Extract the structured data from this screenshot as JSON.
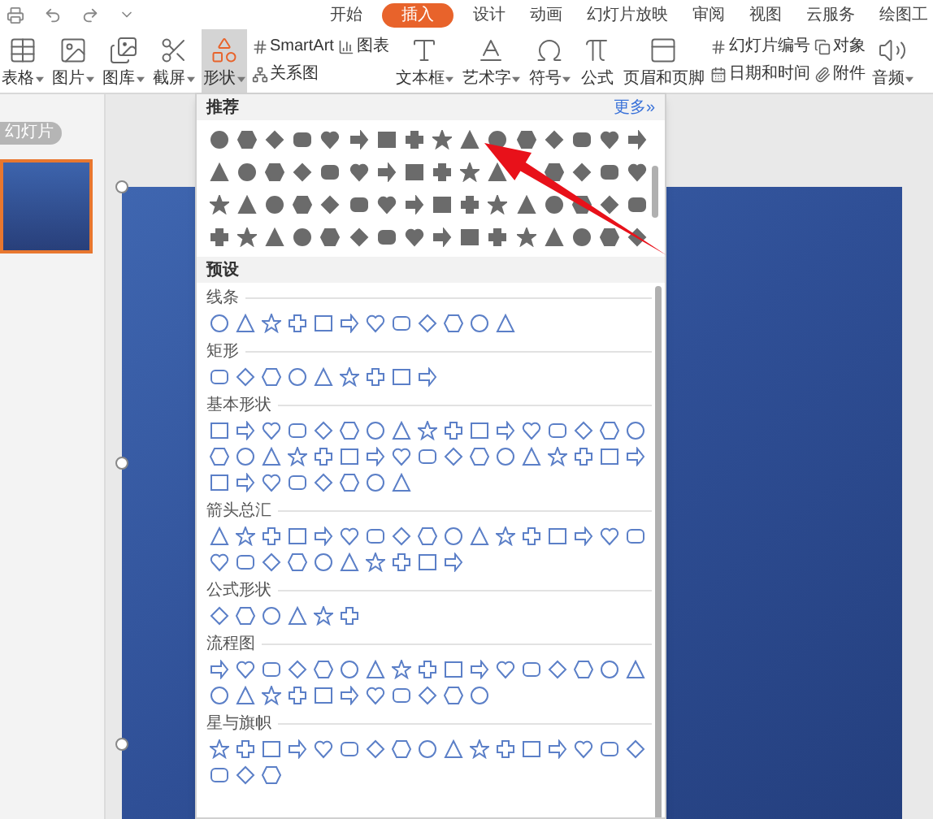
{
  "tabs": [
    {
      "label": "开始",
      "selected": false
    },
    {
      "label": "插入",
      "selected": true
    },
    {
      "label": "设计",
      "selected": false
    },
    {
      "label": "动画",
      "selected": false
    },
    {
      "label": "幻灯片放映",
      "selected": false
    },
    {
      "label": "审阅",
      "selected": false
    },
    {
      "label": "视图",
      "selected": false
    },
    {
      "label": "云服务",
      "selected": false
    },
    {
      "label": "绘图工",
      "selected": false
    }
  ],
  "ribbon": [
    {
      "kind": "large",
      "label": "表格",
      "dropdown": true,
      "selected": false
    },
    {
      "kind": "large",
      "label": "图片",
      "dropdown": true,
      "selected": false
    },
    {
      "kind": "large",
      "label": "图库",
      "dropdown": true,
      "selected": false
    },
    {
      "kind": "large",
      "label": "截屏",
      "dropdown": true,
      "selected": false
    },
    {
      "kind": "large",
      "label": "形状",
      "dropdown": true,
      "selected": true
    },
    {
      "kind": "stack",
      "items": [
        {
          "label": "SmartArt"
        },
        {
          "label": "关系图"
        }
      ]
    },
    {
      "kind": "stack",
      "items": [
        {
          "label": "图表"
        }
      ]
    },
    {
      "kind": "large",
      "label": "文本框",
      "dropdown": true,
      "selected": false
    },
    {
      "kind": "large",
      "label": "艺术字",
      "dropdown": true,
      "selected": false
    },
    {
      "kind": "large",
      "label": "符号",
      "dropdown": true,
      "selected": false
    },
    {
      "kind": "large",
      "label": "公式",
      "dropdown": false,
      "selected": false
    },
    {
      "kind": "large",
      "label": "页眉和页脚",
      "dropdown": false,
      "selected": false
    },
    {
      "kind": "stack",
      "items": [
        {
          "label": "幻灯片编号"
        },
        {
          "label": "日期和时间"
        }
      ]
    },
    {
      "kind": "stack",
      "items": [
        {
          "label": "对象"
        },
        {
          "label": "附件"
        }
      ]
    },
    {
      "kind": "large",
      "label": "音频",
      "dropdown": true,
      "selected": false
    }
  ],
  "slides_panel": {
    "label": "幻灯片",
    "thumbnail": {
      "selected": true
    }
  },
  "shapes_menu": {
    "recommended": {
      "title": "推荐",
      "more": "更多»"
    },
    "presets": {
      "title": "预设",
      "sections": [
        {
          "title": "线条"
        },
        {
          "title": "矩形"
        },
        {
          "title": "基本形状"
        },
        {
          "title": "箭头总汇"
        },
        {
          "title": "公式形状"
        },
        {
          "title": "流程图"
        },
        {
          "title": "星与旗帜"
        }
      ]
    }
  }
}
